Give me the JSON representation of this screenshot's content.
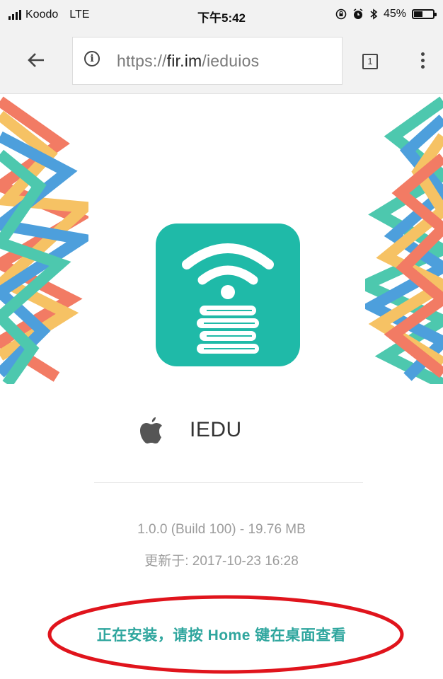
{
  "status_bar": {
    "carrier": "Koodo",
    "network": "LTE",
    "time": "下午5:42",
    "battery": "45%",
    "battery_level": 0.45
  },
  "browser": {
    "url_scheme": "https://",
    "url_host": "fir.im",
    "url_path": "/ieduios",
    "tab_count": "1"
  },
  "app": {
    "name": "IEDU",
    "platform_icon": "apple-icon",
    "icon_color": "#1fbaa8",
    "version_info": "1.0.0 (Build 100) - 19.76 MB",
    "updated": "更新于: 2017-10-23 16:28",
    "install_status": "正在安装，请按 Home 键在桌面查看"
  },
  "colors": {
    "accent": "#2fa69e",
    "annotation": "#e0141c"
  }
}
